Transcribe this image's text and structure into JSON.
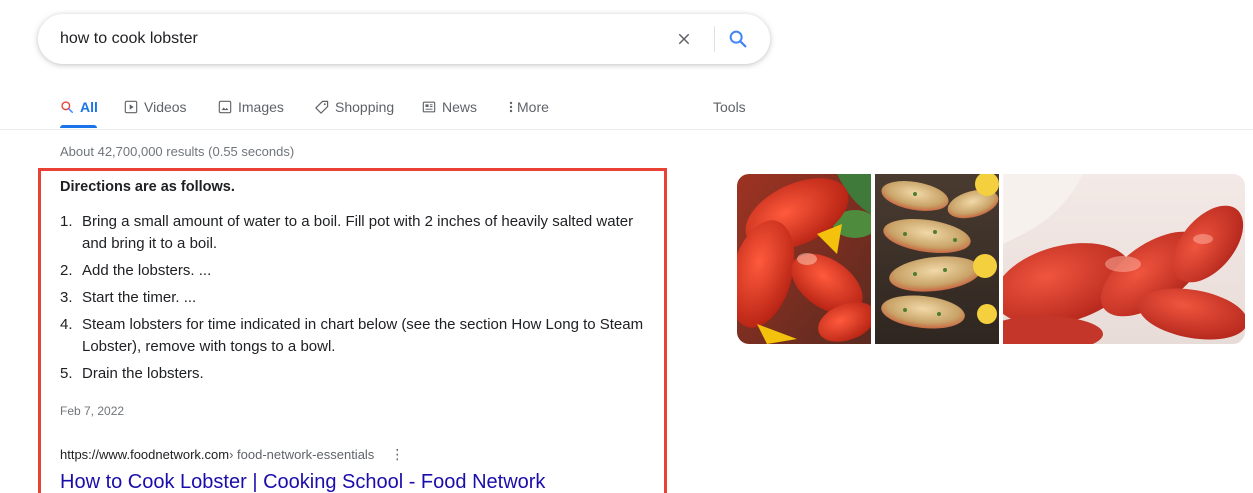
{
  "search": {
    "query": "how to cook lobster"
  },
  "tabs": [
    {
      "label": "All",
      "icon": "search-icon",
      "active": true
    },
    {
      "label": "Videos",
      "icon": "video-icon"
    },
    {
      "label": "Images",
      "icon": "image-icon"
    },
    {
      "label": "Shopping",
      "icon": "tag-icon"
    },
    {
      "label": "News",
      "icon": "news-icon"
    },
    {
      "label": "More",
      "icon": "more-vert-icon"
    }
  ],
  "tools_label": "Tools",
  "result_stats": "About 42,700,000 results (0.55 seconds)",
  "snippet": {
    "heading": "Directions are as follows.",
    "steps": [
      {
        "num": "1.",
        "text": "Bring a small amount of water to a boil. Fill pot with 2 inches of heavily salted water and bring it to a boil."
      },
      {
        "num": "2.",
        "text": "Add the lobsters. ..."
      },
      {
        "num": "3.",
        "text": "Start the timer. ..."
      },
      {
        "num": "4.",
        "text": "Steam lobsters for time indicated in chart below (see the section How Long to Steam Lobster), remove with tongs to a bowl."
      },
      {
        "num": "5.",
        "text": "Drain the lobsters."
      }
    ],
    "date": "Feb 7, 2022",
    "site": "https://www.foodnetwork.com",
    "breadcrumb": " › food-network-essentials",
    "more_glyph": "⋮",
    "title": "How to Cook Lobster | Cooking School - Food Network"
  },
  "colors": {
    "accent": "#1a73e8",
    "link": "#1a0dab",
    "highlight_border": "#e94235"
  }
}
